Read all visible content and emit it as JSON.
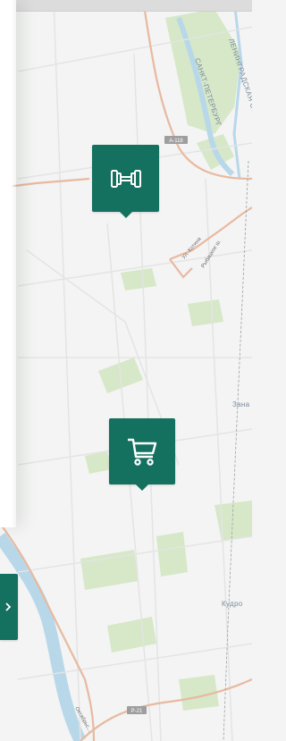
{
  "map": {
    "labels": {
      "region": "ЛЕНИНГРАДСКАЯ ОБЛ.",
      "city": "САНКТ-ПЕТЕРБУРГ",
      "street_1": "Ул. Котина",
      "street_2": "Рыбацкое ш.",
      "street_3": "Октябрьс...",
      "settlement_1": "Зана",
      "settlement_2": "Кудро"
    },
    "road_shields": {
      "a118": "А-118",
      "p21": "Р-21"
    }
  },
  "markers": [
    {
      "category": "gym",
      "icon": "dumbbell-icon"
    },
    {
      "category": "shop",
      "icon": "shopping-cart-icon"
    },
    {
      "category": "partial",
      "icon": "arrow-icon"
    }
  ],
  "colors": {
    "marker": "#14705f",
    "water": "#b8d8ea",
    "green": "#d3e8c5",
    "road": "#e8b9a0",
    "land": "#f3f4f3"
  }
}
